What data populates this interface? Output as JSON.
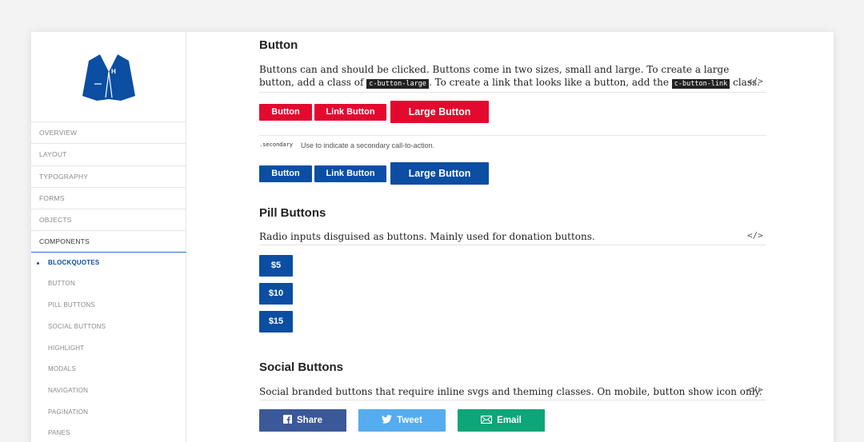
{
  "sidebar": {
    "logo_icon": "blazer-jacket-icon",
    "nav": [
      {
        "label": "OVERVIEW"
      },
      {
        "label": "LAYOUT"
      },
      {
        "label": "TYPOGRAPHY"
      },
      {
        "label": "FORMS"
      },
      {
        "label": "OBJECTS"
      },
      {
        "label": "COMPONENTS"
      }
    ],
    "sub": [
      {
        "label": "BLOCKQUOTES"
      },
      {
        "label": "BUTTON"
      },
      {
        "label": "PILL BUTTONS"
      },
      {
        "label": "SOCIAL BUTTONS"
      },
      {
        "label": "HIGHLIGHT"
      },
      {
        "label": "MODALS"
      },
      {
        "label": "NAVIGATION"
      },
      {
        "label": "PAGINATION"
      },
      {
        "label": "PANES"
      }
    ]
  },
  "button_section": {
    "title": "Button",
    "desc_1": "Buttons can and should be clicked. Buttons come in two sizes, small and large. To create a large button, add a class of",
    "code_large": "c-button-large",
    "desc_2": ". To create a link that looks like a button, add the",
    "code_link": "c-button-link",
    "desc_3": "class.",
    "code_toggle": "</>",
    "primary": {
      "button": "Button",
      "link": "Link Button",
      "large": "Large Button"
    },
    "secondary_tag": ".secondary",
    "secondary_desc": "Use to indicate a secondary call-to-action.",
    "secondary": {
      "button": "Button",
      "link": "Link Button",
      "large": "Large Button"
    }
  },
  "pill_section": {
    "title": "Pill Buttons",
    "desc": "Radio inputs disguised as buttons. Mainly used for donation buttons.",
    "code_toggle": "</>",
    "pills": [
      "$5",
      "$10",
      "$15"
    ]
  },
  "social_section": {
    "title": "Social Buttons",
    "desc": "Social branded buttons that require inline svgs and theming classes. On mobile, button show icon only.",
    "code_toggle": "</>",
    "share": "Share",
    "tweet": "Tweet",
    "email": "Email"
  },
  "colors": {
    "red": "#e3092f",
    "blue": "#0b4ea2",
    "facebook": "#3b5998",
    "twitter": "#55acee",
    "email": "#0ca678"
  }
}
